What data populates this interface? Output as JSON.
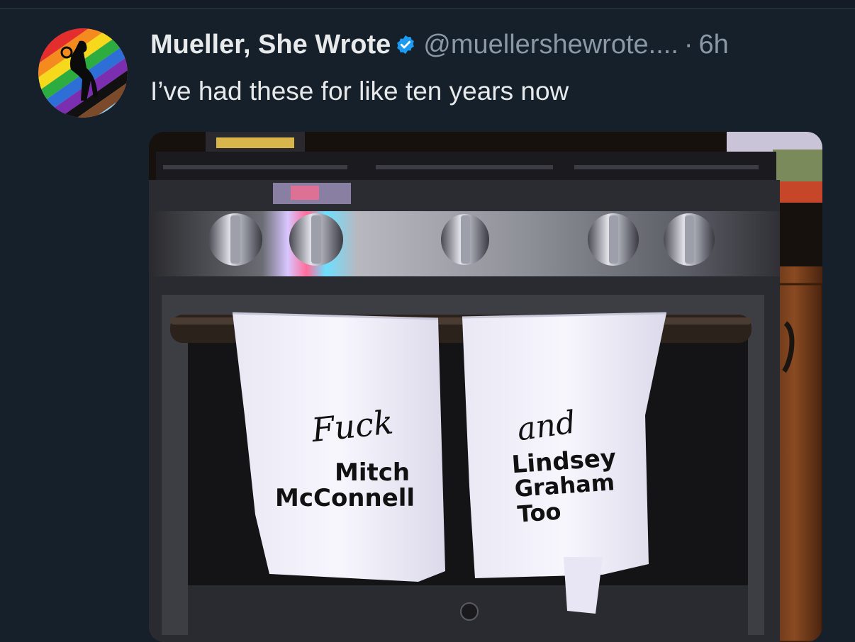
{
  "tweet": {
    "author_name": "Mueller, She Wrote",
    "handle": "@muellershewrote....",
    "separator": "·",
    "time": "6h",
    "text": "I’ve had these for like ten years now",
    "verified": true
  },
  "media": {
    "towel_left": {
      "script_word": "Fuck",
      "line1": "Mitch",
      "line2": "McConnell"
    },
    "towel_right": {
      "script_word": "and",
      "line1": "Lindsey",
      "line2": "Graham",
      "line3": "Too"
    }
  },
  "icons": {
    "verified": "verified-badge-icon"
  },
  "colors": {
    "background": "#15202b",
    "text_primary": "#e7e9ea",
    "text_secondary": "#8b98a5",
    "verified_blue": "#1d9bf0"
  }
}
